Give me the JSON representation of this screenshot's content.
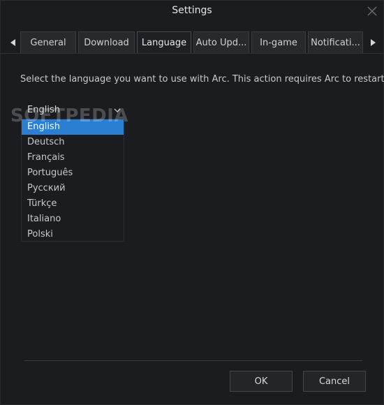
{
  "window": {
    "title": "Settings",
    "close_icon": "close-icon"
  },
  "tabs": [
    {
      "label": "General",
      "active": false
    },
    {
      "label": "Download",
      "active": false
    },
    {
      "label": "Language",
      "active": true
    },
    {
      "label": "Auto Upd...",
      "active": false
    },
    {
      "label": "In-game",
      "active": false
    },
    {
      "label": "Notificati...",
      "active": false
    }
  ],
  "tab_nav": {
    "left_icon": "triangle-left-icon",
    "right_icon": "triangle-right-icon"
  },
  "language": {
    "instruction": "Select the language you want to use with Arc. This action requires Arc to restart.",
    "selected": "English",
    "options": [
      "English",
      "Deutsch",
      "Français",
      "Português",
      "Русский",
      "Türkçe",
      "Italiano",
      "Polski"
    ]
  },
  "watermark": "SOFTPEDIA",
  "footer": {
    "ok_label": "OK",
    "cancel_label": "Cancel"
  },
  "colors": {
    "background": "#1b1c1f",
    "accent": "#2b7fd3"
  }
}
